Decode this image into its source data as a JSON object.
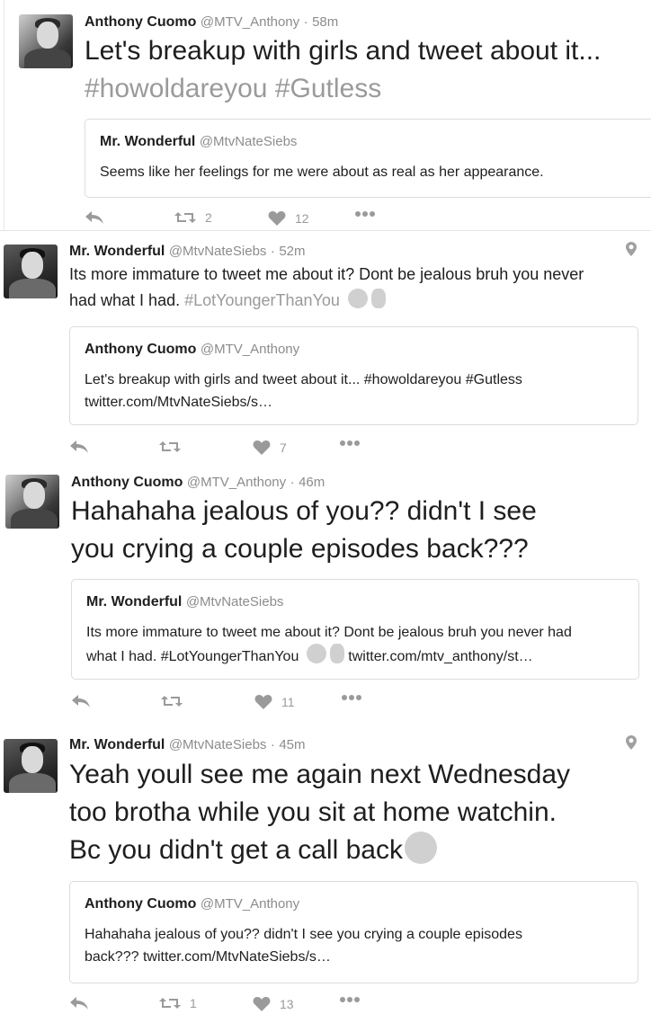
{
  "tweets": [
    {
      "name": "Anthony Cuomo",
      "handle": "@MTV_Anthony",
      "time": "58m",
      "text": "Let's breakup with girls and tweet about it...",
      "hashtags": "#howoldareyou #Gutless",
      "quote": {
        "name": "Mr. Wonderful",
        "handle": "@MtvNateSiebs",
        "text": "Seems like her feelings for me were about as real as her appearance."
      },
      "retweets": "2",
      "likes": "12"
    },
    {
      "name": "Mr. Wonderful",
      "handle": "@MtvNateSiebs",
      "time": "52m",
      "text": "Its more immature to tweet me about it? Dont be jealous bruh you never had what I had.",
      "hashtags": "#LotYoungerThanYou",
      "quote": {
        "name": "Anthony Cuomo",
        "handle": "@MTV_Anthony",
        "text_line1": "Let's breakup with girls and tweet about it... #howoldareyou #Gutless",
        "text_line2": "twitter.com/MtvNateSiebs/s…"
      },
      "retweets": "",
      "likes": "7"
    },
    {
      "name": "Anthony Cuomo",
      "handle": "@MTV_Anthony",
      "time": "46m",
      "text_line1": "Hahahaha jealous of you?? didn't I see",
      "text_line2": "you crying a couple episodes back???",
      "quote": {
        "name": "Mr. Wonderful",
        "handle": "@MtvNateSiebs",
        "text_line1": "Its more immature to tweet me about it? Dont be jealous bruh you never had",
        "text_line2a": "what I had. #LotYoungerThanYou",
        "text_line2b": "twitter.com/mtv_anthony/st…"
      },
      "retweets": "",
      "likes": "11"
    },
    {
      "name": "Mr. Wonderful",
      "handle": "@MtvNateSiebs",
      "time": "45m",
      "text_line1": "Yeah youll see me again next Wednesday",
      "text_line2": "too brotha  while you sit at home watchin.",
      "text_line3": "Bc you didn't get a call back",
      "quote": {
        "name": "Anthony Cuomo",
        "handle": "@MTV_Anthony",
        "text_line1": "Hahahaha jealous of you?? didn't I see you crying a couple episodes",
        "text_line2": "back??? twitter.com/MtvNateSiebs/s…"
      },
      "retweets": "1",
      "likes": "13"
    }
  ],
  "separator": "·",
  "icons": {
    "reply": "reply-icon",
    "retweet": "retweet-icon",
    "like": "heart-icon",
    "more": "more-icon",
    "location": "location-pin-icon",
    "emoji_clap": "clapping-hands-emoji",
    "emoji_finger": "middle-finger-emoji",
    "emoji_thinking": "thinking-face-emoji"
  },
  "colors": {
    "text": "#1e1e1e",
    "muted": "#8c8c8c",
    "hashtag": "#9a9a9a",
    "border": "#dcdcdc"
  }
}
